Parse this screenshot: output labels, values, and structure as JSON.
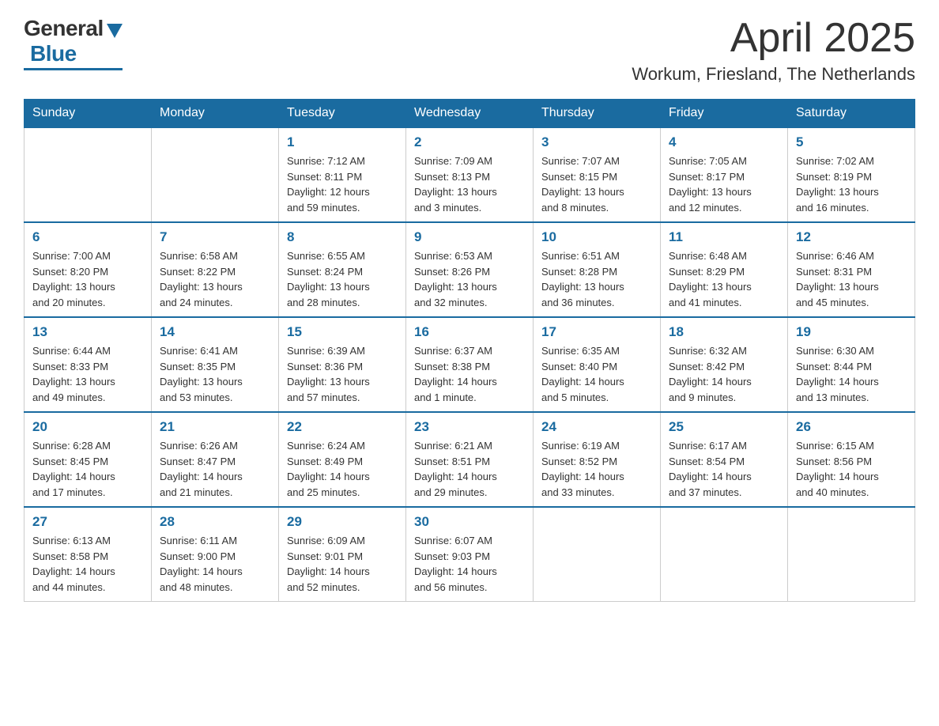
{
  "logo": {
    "general": "General",
    "blue": "Blue"
  },
  "header": {
    "month": "April 2025",
    "location": "Workum, Friesland, The Netherlands"
  },
  "weekdays": [
    "Sunday",
    "Monday",
    "Tuesday",
    "Wednesday",
    "Thursday",
    "Friday",
    "Saturday"
  ],
  "weeks": [
    [
      {
        "day": "",
        "info": ""
      },
      {
        "day": "",
        "info": ""
      },
      {
        "day": "1",
        "info": "Sunrise: 7:12 AM\nSunset: 8:11 PM\nDaylight: 12 hours\nand 59 minutes."
      },
      {
        "day": "2",
        "info": "Sunrise: 7:09 AM\nSunset: 8:13 PM\nDaylight: 13 hours\nand 3 minutes."
      },
      {
        "day": "3",
        "info": "Sunrise: 7:07 AM\nSunset: 8:15 PM\nDaylight: 13 hours\nand 8 minutes."
      },
      {
        "day": "4",
        "info": "Sunrise: 7:05 AM\nSunset: 8:17 PM\nDaylight: 13 hours\nand 12 minutes."
      },
      {
        "day": "5",
        "info": "Sunrise: 7:02 AM\nSunset: 8:19 PM\nDaylight: 13 hours\nand 16 minutes."
      }
    ],
    [
      {
        "day": "6",
        "info": "Sunrise: 7:00 AM\nSunset: 8:20 PM\nDaylight: 13 hours\nand 20 minutes."
      },
      {
        "day": "7",
        "info": "Sunrise: 6:58 AM\nSunset: 8:22 PM\nDaylight: 13 hours\nand 24 minutes."
      },
      {
        "day": "8",
        "info": "Sunrise: 6:55 AM\nSunset: 8:24 PM\nDaylight: 13 hours\nand 28 minutes."
      },
      {
        "day": "9",
        "info": "Sunrise: 6:53 AM\nSunset: 8:26 PM\nDaylight: 13 hours\nand 32 minutes."
      },
      {
        "day": "10",
        "info": "Sunrise: 6:51 AM\nSunset: 8:28 PM\nDaylight: 13 hours\nand 36 minutes."
      },
      {
        "day": "11",
        "info": "Sunrise: 6:48 AM\nSunset: 8:29 PM\nDaylight: 13 hours\nand 41 minutes."
      },
      {
        "day": "12",
        "info": "Sunrise: 6:46 AM\nSunset: 8:31 PM\nDaylight: 13 hours\nand 45 minutes."
      }
    ],
    [
      {
        "day": "13",
        "info": "Sunrise: 6:44 AM\nSunset: 8:33 PM\nDaylight: 13 hours\nand 49 minutes."
      },
      {
        "day": "14",
        "info": "Sunrise: 6:41 AM\nSunset: 8:35 PM\nDaylight: 13 hours\nand 53 minutes."
      },
      {
        "day": "15",
        "info": "Sunrise: 6:39 AM\nSunset: 8:36 PM\nDaylight: 13 hours\nand 57 minutes."
      },
      {
        "day": "16",
        "info": "Sunrise: 6:37 AM\nSunset: 8:38 PM\nDaylight: 14 hours\nand 1 minute."
      },
      {
        "day": "17",
        "info": "Sunrise: 6:35 AM\nSunset: 8:40 PM\nDaylight: 14 hours\nand 5 minutes."
      },
      {
        "day": "18",
        "info": "Sunrise: 6:32 AM\nSunset: 8:42 PM\nDaylight: 14 hours\nand 9 minutes."
      },
      {
        "day": "19",
        "info": "Sunrise: 6:30 AM\nSunset: 8:44 PM\nDaylight: 14 hours\nand 13 minutes."
      }
    ],
    [
      {
        "day": "20",
        "info": "Sunrise: 6:28 AM\nSunset: 8:45 PM\nDaylight: 14 hours\nand 17 minutes."
      },
      {
        "day": "21",
        "info": "Sunrise: 6:26 AM\nSunset: 8:47 PM\nDaylight: 14 hours\nand 21 minutes."
      },
      {
        "day": "22",
        "info": "Sunrise: 6:24 AM\nSunset: 8:49 PM\nDaylight: 14 hours\nand 25 minutes."
      },
      {
        "day": "23",
        "info": "Sunrise: 6:21 AM\nSunset: 8:51 PM\nDaylight: 14 hours\nand 29 minutes."
      },
      {
        "day": "24",
        "info": "Sunrise: 6:19 AM\nSunset: 8:52 PM\nDaylight: 14 hours\nand 33 minutes."
      },
      {
        "day": "25",
        "info": "Sunrise: 6:17 AM\nSunset: 8:54 PM\nDaylight: 14 hours\nand 37 minutes."
      },
      {
        "day": "26",
        "info": "Sunrise: 6:15 AM\nSunset: 8:56 PM\nDaylight: 14 hours\nand 40 minutes."
      }
    ],
    [
      {
        "day": "27",
        "info": "Sunrise: 6:13 AM\nSunset: 8:58 PM\nDaylight: 14 hours\nand 44 minutes."
      },
      {
        "day": "28",
        "info": "Sunrise: 6:11 AM\nSunset: 9:00 PM\nDaylight: 14 hours\nand 48 minutes."
      },
      {
        "day": "29",
        "info": "Sunrise: 6:09 AM\nSunset: 9:01 PM\nDaylight: 14 hours\nand 52 minutes."
      },
      {
        "day": "30",
        "info": "Sunrise: 6:07 AM\nSunset: 9:03 PM\nDaylight: 14 hours\nand 56 minutes."
      },
      {
        "day": "",
        "info": ""
      },
      {
        "day": "",
        "info": ""
      },
      {
        "day": "",
        "info": ""
      }
    ]
  ]
}
